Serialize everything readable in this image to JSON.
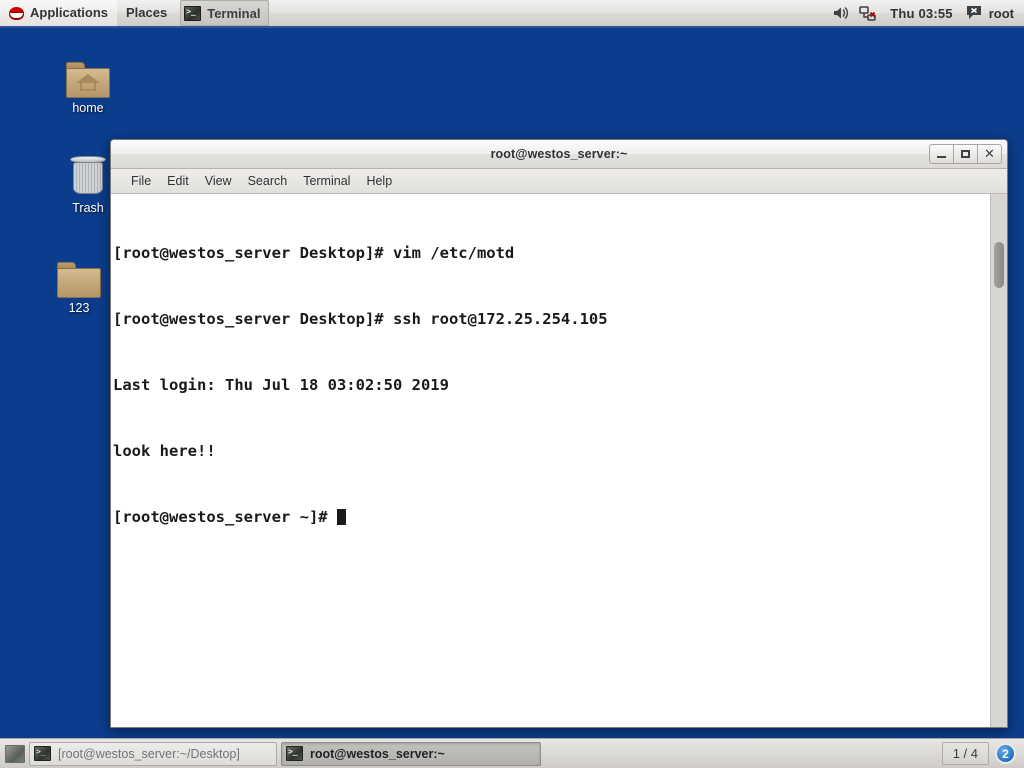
{
  "top_panel": {
    "logo_icon": "redhat-logo-icon",
    "applications_label": "Applications",
    "places_label": "Places",
    "window_button_label": "Terminal",
    "window_button_icon": "terminal-icon",
    "volume_icon": "speaker-icon",
    "network_icon": "network-disconnected-icon",
    "clock": "Thu 03:55",
    "user": "root",
    "user_icon": "user-status-icon"
  },
  "desktop": {
    "background_color": "#0b3d8c",
    "icons": [
      {
        "name": "home",
        "label": "home",
        "icon": "folder-home-icon"
      },
      {
        "name": "trash",
        "label": "Trash",
        "icon": "trash-icon"
      },
      {
        "name": "123",
        "label": "123",
        "icon": "folder-icon"
      }
    ]
  },
  "terminal_window": {
    "title": "root@westos_server:~",
    "menu": [
      "File",
      "Edit",
      "View",
      "Search",
      "Terminal",
      "Help"
    ],
    "window_controls": {
      "minimize": "minimize-icon",
      "maximize": "maximize-icon",
      "close": "close-icon"
    },
    "background_color": "#ffffff",
    "text_color": "#1a1a1a",
    "lines": [
      "[root@westos_server Desktop]# vim /etc/motd",
      "[root@westos_server Desktop]# ssh root@172.25.254.105",
      "Last login: Thu Jul 18 03:02:50 2019",
      "look here!!",
      "[root@westos_server ~]# "
    ]
  },
  "bottom_panel": {
    "tasks": [
      {
        "label": "[root@westos_server:~/Desktop]",
        "icon": "terminal-icon",
        "active": false
      },
      {
        "label": "root@westos_server:~",
        "icon": "terminal-icon",
        "active": true
      }
    ],
    "workspace": "1 / 4",
    "notification_count": "2"
  }
}
